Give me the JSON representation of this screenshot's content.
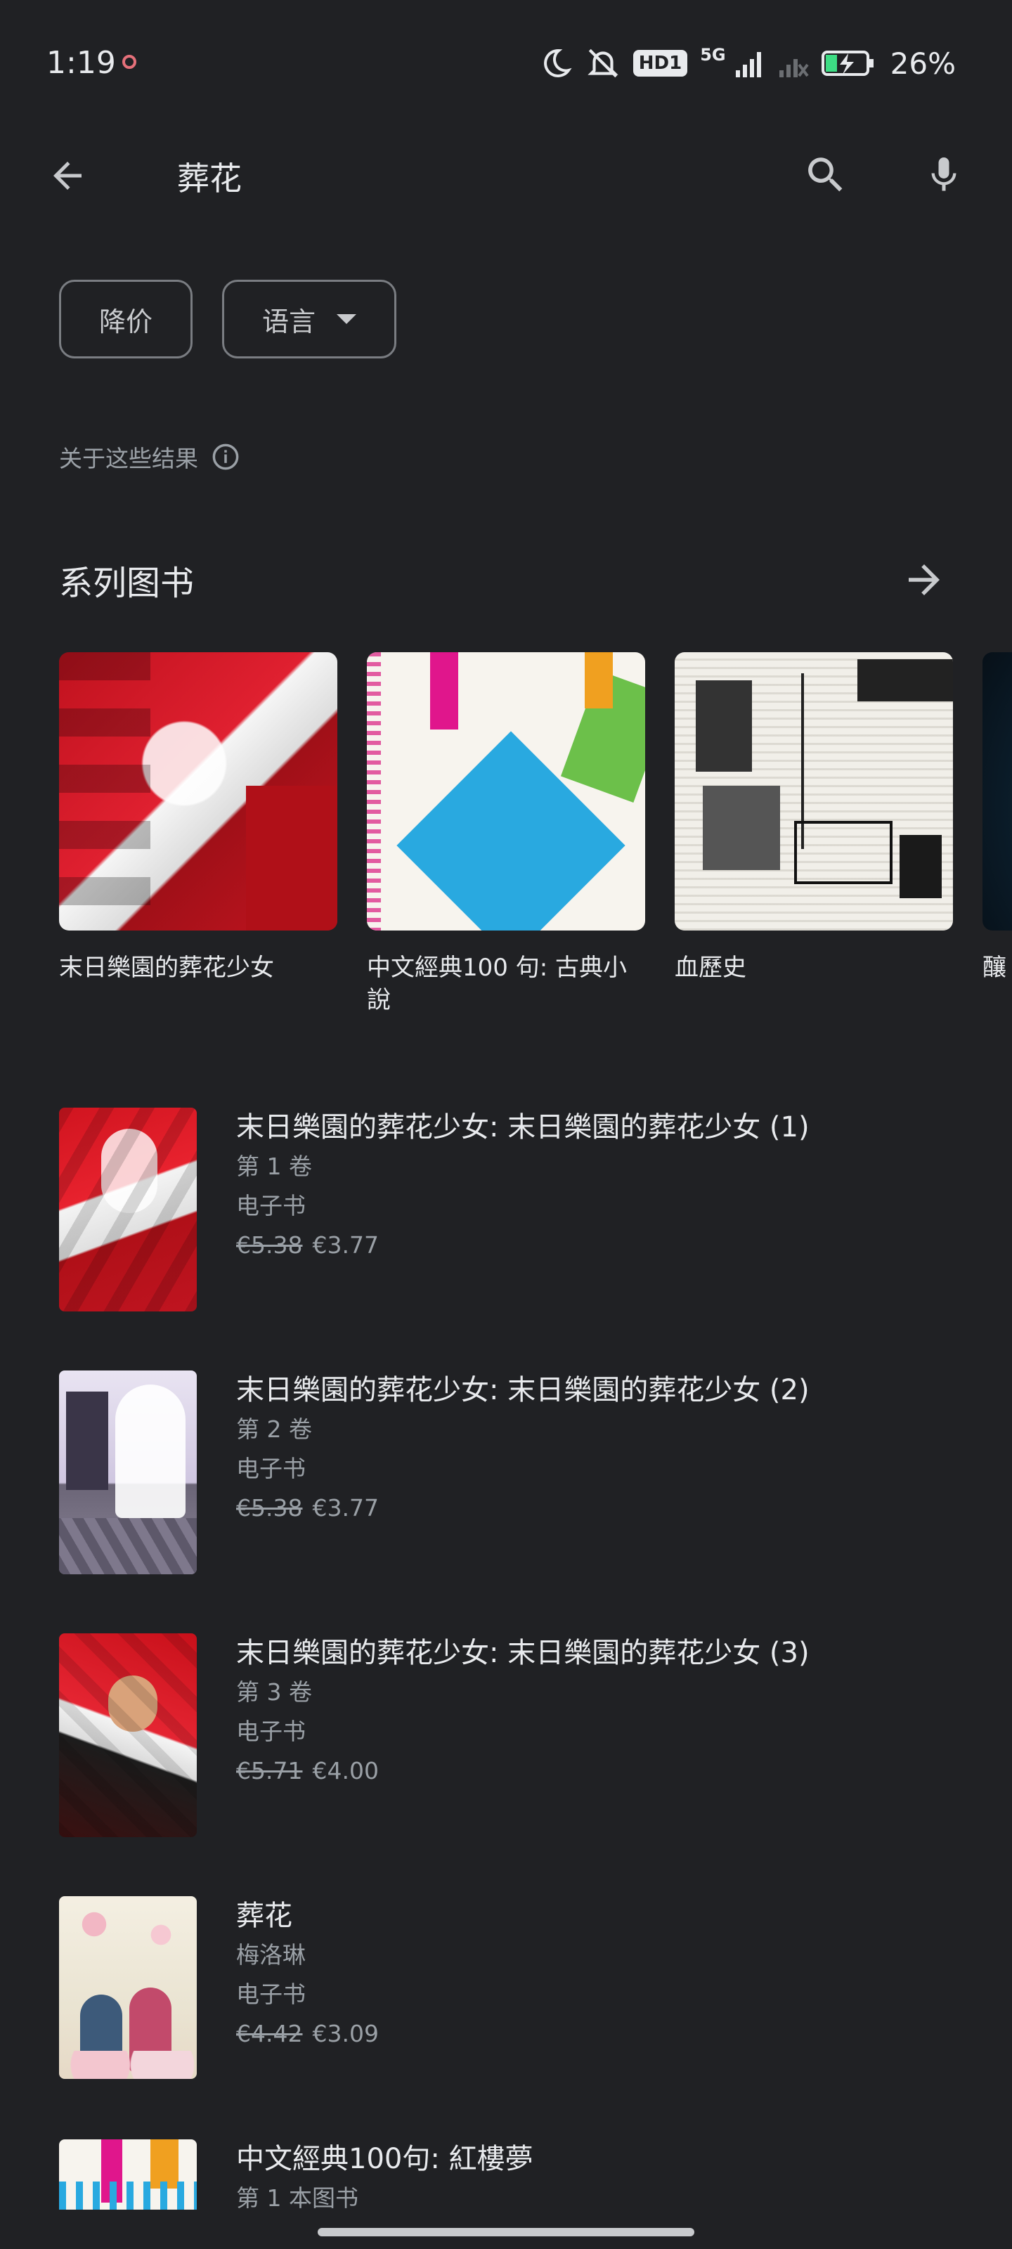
{
  "status_bar": {
    "time": "1:19",
    "hd_label": "HD1",
    "network": "5G",
    "battery_percent": "26%",
    "icons": [
      "moon-icon",
      "mute-icon",
      "signal-icon",
      "battery-charging-icon"
    ]
  },
  "search": {
    "query": "葬花",
    "icons": [
      "back-arrow-icon",
      "search-icon",
      "mic-icon"
    ]
  },
  "filters": [
    {
      "label": "降价"
    },
    {
      "label": "语言",
      "icon": "caret-down-icon"
    }
  ],
  "about_results": {
    "label": "关于这些结果",
    "icon": "info-icon"
  },
  "series": {
    "title": "系列图书",
    "more_icon": "arrow-right-icon",
    "items": [
      {
        "label": "末日樂園的葬花少女"
      },
      {
        "label": "中文經典100 句: 古典小說"
      },
      {
        "label": "血歷史"
      },
      {
        "label": "釀"
      }
    ]
  },
  "books": [
    {
      "title": "末日樂園的葬花少女: 末日樂園的葬花少女 (1)",
      "subtitle": "第 1 卷",
      "format": "电子书",
      "old_price": "€5.38",
      "price": "€3.77"
    },
    {
      "title": "末日樂園的葬花少女: 末日樂園的葬花少女 (2)",
      "subtitle": "第 2 卷",
      "format": "电子书",
      "old_price": "€5.38",
      "price": "€3.77"
    },
    {
      "title": "末日樂園的葬花少女: 末日樂園的葬花少女 (3)",
      "subtitle": "第 3 卷",
      "format": "电子书",
      "old_price": "€5.71",
      "price": "€4.00"
    },
    {
      "title": "葬花",
      "subtitle": "梅洛琳",
      "format": "电子书",
      "old_price": "€4.42",
      "price": "€3.09"
    },
    {
      "title": "中文經典100句: 紅樓夢",
      "subtitle": "第 1 本图书"
    }
  ],
  "colors": {
    "background": "#202124",
    "text_primary": "#e8eaed",
    "text_secondary": "#9aa0a6",
    "chip_border": "#7a7d82"
  }
}
